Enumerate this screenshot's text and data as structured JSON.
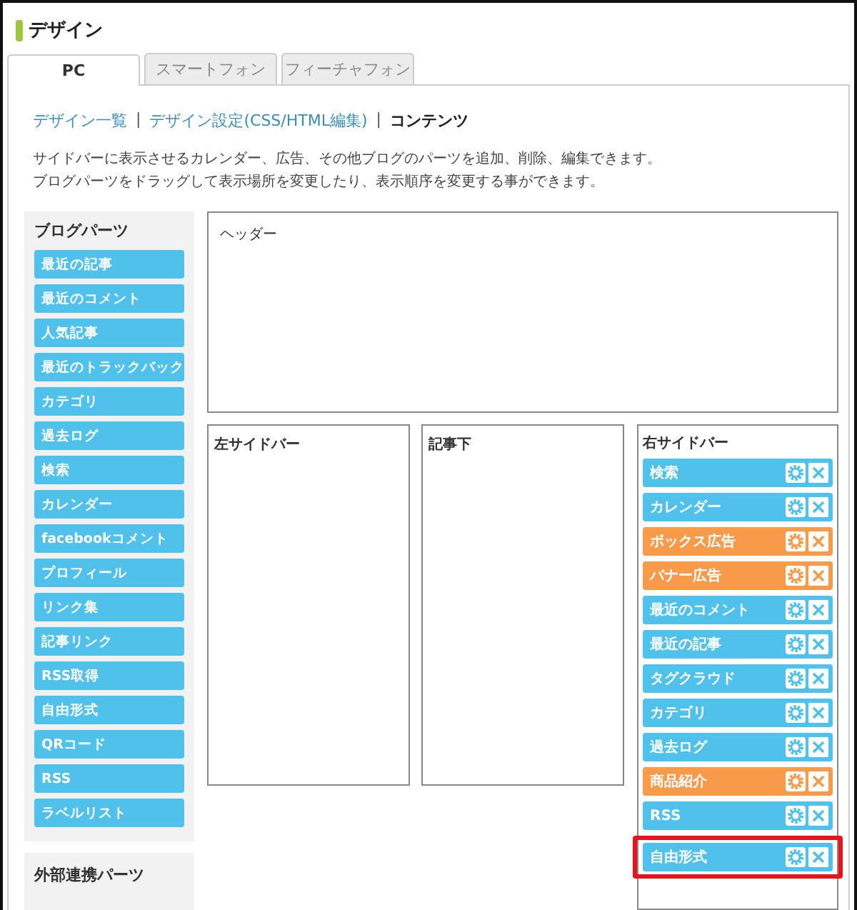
{
  "page_title": "デザイン",
  "tabs": [
    {
      "label": "PC",
      "selected": true
    },
    {
      "label": "スマートフォン",
      "selected": false
    },
    {
      "label": "フィーチャフォン",
      "selected": false
    }
  ],
  "breadcrumb": [
    {
      "label": "デザイン一覧",
      "kind": "link"
    },
    {
      "label": "|",
      "kind": "separator"
    },
    {
      "label": "デザイン設定(CSS/HTML編集)",
      "kind": "link"
    },
    {
      "label": "|",
      "kind": "separator"
    },
    {
      "label": "コンテンツ",
      "kind": "current"
    }
  ],
  "description": [
    "サイドバーに表示させるカレンダー、広告、その他ブログのパーツを追加、削除、編集できます。",
    "ブログパーツをドラッグして表示場所を変更したり、表示順序を変更する事ができます。"
  ],
  "palette": {
    "title": "ブログパーツ",
    "items": [
      "最近の記事",
      "最近のコメント",
      "人気記事",
      "最近のトラックバック",
      "カテゴリ",
      "過去ログ",
      "検索",
      "カレンダー",
      "facebookコメント",
      "プロフィール",
      "リンク集",
      "記事リンク",
      "RSS取得",
      "自由形式",
      "QRコード",
      "RSS",
      "ラベルリスト"
    ]
  },
  "external_parts": {
    "title": "外部連携パーツ"
  },
  "header_area": {
    "title": "ヘッダー"
  },
  "left_sidebar": {
    "title": "左サイドバー"
  },
  "below_article": {
    "title": "記事下"
  },
  "right_sidebar": {
    "title": "右サイドバー",
    "items": [
      {
        "label": "検索",
        "color": "#4fc1ea",
        "highlighted": false
      },
      {
        "label": "カレンダー",
        "color": "#4fc1ea",
        "highlighted": false
      },
      {
        "label": "ボックス広告",
        "color": "#f79a4a",
        "highlighted": false
      },
      {
        "label": "バナー広告",
        "color": "#f79a4a",
        "highlighted": false
      },
      {
        "label": "最近のコメント",
        "color": "#4fc1ea",
        "highlighted": false
      },
      {
        "label": "最近の記事",
        "color": "#4fc1ea",
        "highlighted": false
      },
      {
        "label": "タグクラウド",
        "color": "#4fc1ea",
        "highlighted": false
      },
      {
        "label": "カテゴリ",
        "color": "#4fc1ea",
        "highlighted": false
      },
      {
        "label": "過去ログ",
        "color": "#4fc1ea",
        "highlighted": false
      },
      {
        "label": "商品紹介",
        "color": "#f79a4a",
        "highlighted": false
      },
      {
        "label": "RSS",
        "color": "#4fc1ea",
        "highlighted": false
      },
      {
        "label": "自由形式",
        "color": "#4fc1ea",
        "highlighted": true
      }
    ]
  }
}
